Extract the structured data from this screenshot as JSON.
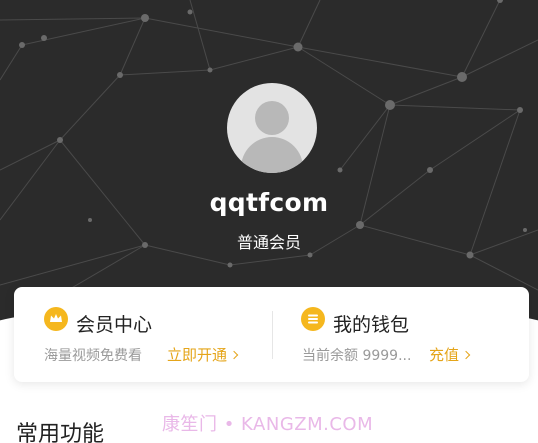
{
  "profile": {
    "username": "qqtfcom",
    "level": "普通会员"
  },
  "vip": {
    "icon": "crown-icon",
    "title": "会员中心",
    "subtitle": "海量视频免费看",
    "action": "立即开通"
  },
  "wallet": {
    "icon": "wallet-icon",
    "title": "我的钱包",
    "subtitle": "当前余额 9999...",
    "action": "充值"
  },
  "section": {
    "title": "常用功能"
  },
  "watermark": "康笙门 • KANGZM.COM",
  "colors": {
    "hero_background": "#2b2b2b",
    "accent_gold": "#e5a51a",
    "coin": "#f5b71e"
  }
}
